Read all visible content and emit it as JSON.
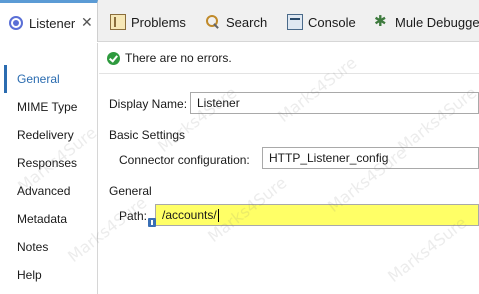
{
  "editor_tab": {
    "label": "Listener",
    "close": "✕"
  },
  "view_tabs": [
    {
      "label": "Problems",
      "icon": "problems-icon"
    },
    {
      "label": "Search",
      "icon": "search-icon"
    },
    {
      "label": "Console",
      "icon": "console-icon"
    },
    {
      "label": "Mule Debugger",
      "icon": "debugger-icon"
    }
  ],
  "sidebar": {
    "items": [
      {
        "label": "General",
        "active": true
      },
      {
        "label": "MIME Type"
      },
      {
        "label": "Redelivery"
      },
      {
        "label": "Responses"
      },
      {
        "label": "Advanced"
      },
      {
        "label": "Metadata"
      },
      {
        "label": "Notes"
      },
      {
        "label": "Help"
      }
    ]
  },
  "main": {
    "status": "There are no errors.",
    "display_name_label": "Display Name:",
    "display_name_value": "Listener",
    "basic_settings_heading": "Basic Settings",
    "connector_config_label": "Connector configuration:",
    "connector_config_value": "HTTP_Listener_config",
    "general_heading": "General",
    "path_label": "Path:",
    "path_value": "/accounts/"
  },
  "watermark": "Marks4Sure",
  "colors": {
    "accent": "#2b6cb0",
    "highlight": "#ffff66",
    "ok": "#2e9a3e"
  }
}
